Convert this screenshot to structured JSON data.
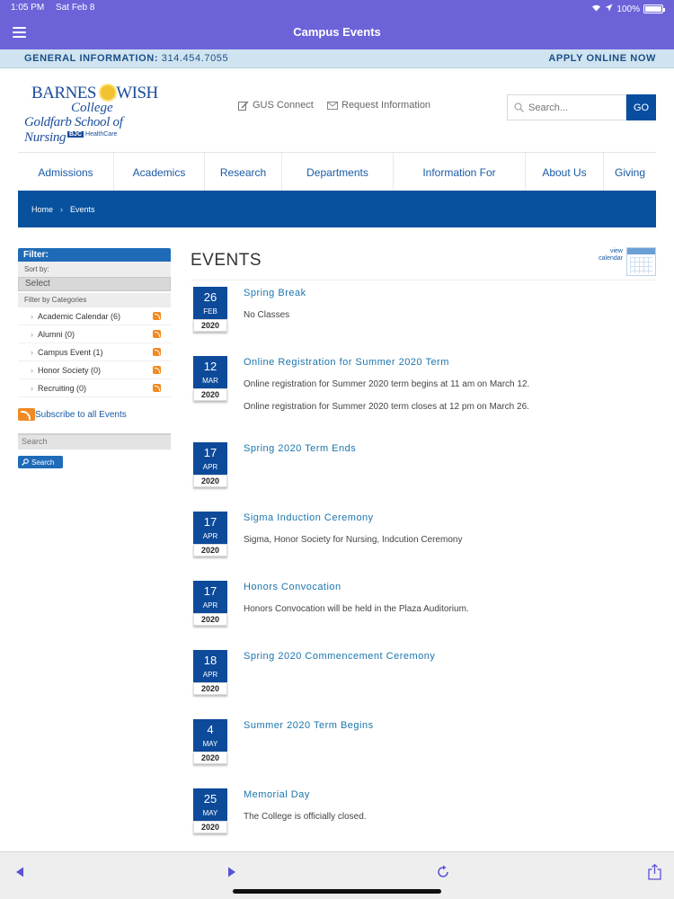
{
  "status": {
    "time": "1:05 PM",
    "date": "Sat Feb 8",
    "battery": "100%"
  },
  "app": {
    "title": "Campus Events"
  },
  "infobar": {
    "label": "GENERAL INFORMATION:",
    "phone": "314.454.7055",
    "apply": "APPLY ONLINE NOW"
  },
  "logo": {
    "line1": "BARNES  JEWISH",
    "line2": "College",
    "line3": "Goldfarb School of Nursing",
    "badge": "BJC",
    "line4": "HealthCare"
  },
  "header": {
    "gus": "GUS Connect",
    "request": "Request Information",
    "search_placeholder": "Search...",
    "go": "GO"
  },
  "nav": [
    "Admissions",
    "Academics",
    "Research",
    "Departments",
    "Information For",
    "About Us",
    "Giving"
  ],
  "breadcrumb": {
    "home": "Home",
    "current": "Events"
  },
  "sidebar": {
    "filter": "Filter:",
    "sort_by": "Sort by:",
    "select": "Select",
    "filter_by": "Filter by Categories",
    "categories": [
      "Academic Calendar (6)",
      "Alumni (0)",
      "Campus Event (1)",
      "Honor Society (0)",
      "Recruiting (0)"
    ],
    "subscribe": "Subscribe to all Events",
    "search_placeholder": "Search",
    "search_button": "Search"
  },
  "events_title": "EVENTS",
  "view_calendar": {
    "line1": "view",
    "line2": "calendar"
  },
  "events": [
    {
      "day": "26",
      "month": "FEB",
      "year": "2020",
      "title": "Spring Break",
      "desc": [
        "No Classes"
      ]
    },
    {
      "day": "12",
      "month": "MAR",
      "year": "2020",
      "title": "Online Registration for Summer 2020 Term",
      "desc": [
        "Online registration for Summer 2020 term begins at 11 am on March 12.",
        "Online registration for Summer 2020 term closes at 12 pm on March 26."
      ]
    },
    {
      "day": "17",
      "month": "APR",
      "year": "2020",
      "title": "Spring 2020 Term Ends",
      "desc": []
    },
    {
      "day": "17",
      "month": "APR",
      "year": "2020",
      "title": "Sigma Induction Ceremony",
      "desc": [
        "Sigma, Honor Society for Nursing, Indcution Ceremony"
      ]
    },
    {
      "day": "17",
      "month": "APR",
      "year": "2020",
      "title": "Honors Convocation",
      "desc": [
        "Honors Convocation will be held in the Plaza Auditorium."
      ]
    },
    {
      "day": "18",
      "month": "APR",
      "year": "2020",
      "title": "Spring 2020 Commencement Ceremony",
      "desc": []
    },
    {
      "day": "4",
      "month": "MAY",
      "year": "2020",
      "title": "Summer 2020 Term Begins",
      "desc": []
    },
    {
      "day": "25",
      "month": "MAY",
      "year": "2020",
      "title": "Memorial Day",
      "desc": [
        "The College is officially closed."
      ]
    }
  ],
  "toolbar": {
    "icons": [
      "back-icon",
      "forward-icon",
      "reload-icon",
      "share-icon"
    ]
  },
  "colors": {
    "navbar": "#6c63d9",
    "brand_blue": "#07519e",
    "link": "#1b75ac"
  }
}
